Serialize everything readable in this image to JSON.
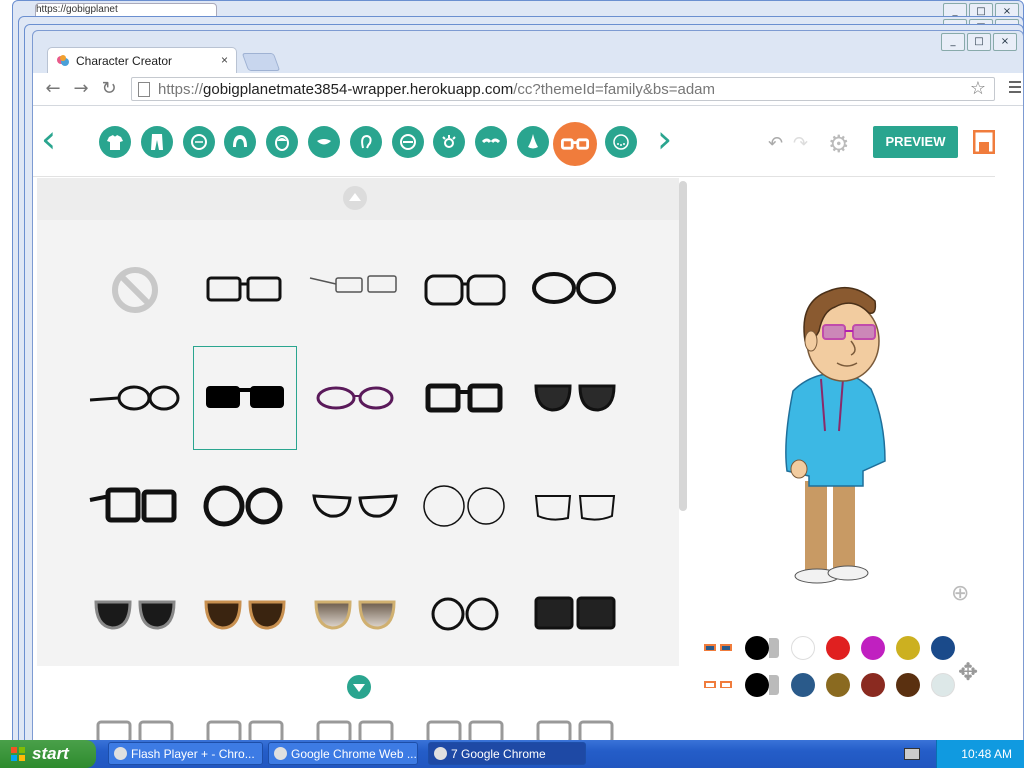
{
  "background_windows": [
    {
      "tab_title": "https://gobigplanet"
    },
    {
      "tab_title": ""
    },
    {
      "tab_title": ""
    }
  ],
  "browser": {
    "tab_title": "Character Creator",
    "tab_close": "×",
    "url_prefix": "https://",
    "url_host": "gobigplanetmate3854-wrapper.herokuapp.com",
    "url_path": "/cc?themeId=family&bs=adam",
    "window_buttons": [
      "_",
      "□",
      "×"
    ]
  },
  "editor": {
    "categories": [
      "shirt-icon",
      "pants-icon",
      "face-shape-icon",
      "hair-icon",
      "head-icon",
      "mouth-icon",
      "ear-icon",
      "eyes-shape-icon",
      "eye-icon",
      "eyebrows-icon",
      "nose-icon",
      "glasses-icon",
      "facial-hair-icon"
    ],
    "active_category": "glasses-icon",
    "nav_prev": "‹",
    "nav_next": "›",
    "preview_label": "PREVIEW",
    "undo": "↶",
    "redo": "↷",
    "settings": "⚙"
  },
  "glasses_grid": {
    "items": [
      "none",
      "rectangle-thin",
      "rimless-side",
      "rectangle-rounded",
      "round-bold",
      "round-side",
      "sunglasses-black",
      "oval-purple",
      "square-bold",
      "aviator-dark",
      "square-side-thick",
      "round-large",
      "cat-eye",
      "round-thin",
      "semi-rimless",
      "aviator-black",
      "aviator-brown",
      "aviator-gradient",
      "round-medium",
      "square-white-frame",
      "partial-1",
      "partial-2",
      "partial-3",
      "partial-4",
      "partial-5"
    ],
    "selected_index": 6
  },
  "colors": {
    "row1": [
      "#000000",
      "#ffffff",
      "#e02020",
      "#c020c0",
      "#ccb020",
      "#1a4a8a"
    ],
    "row2": [
      "#000000",
      "#2a5a8a",
      "#8a6a20",
      "#8a2a20",
      "#5a3010",
      "#dde8e8"
    ]
  },
  "taskbar": {
    "start_label": "start",
    "items": [
      {
        "label": "Flash Player + - Chro...",
        "active": false
      },
      {
        "label": "Google Chrome Web ...",
        "active": false
      },
      {
        "label": "7 Google Chrome",
        "active": true
      }
    ],
    "clock": "10:48 AM"
  }
}
